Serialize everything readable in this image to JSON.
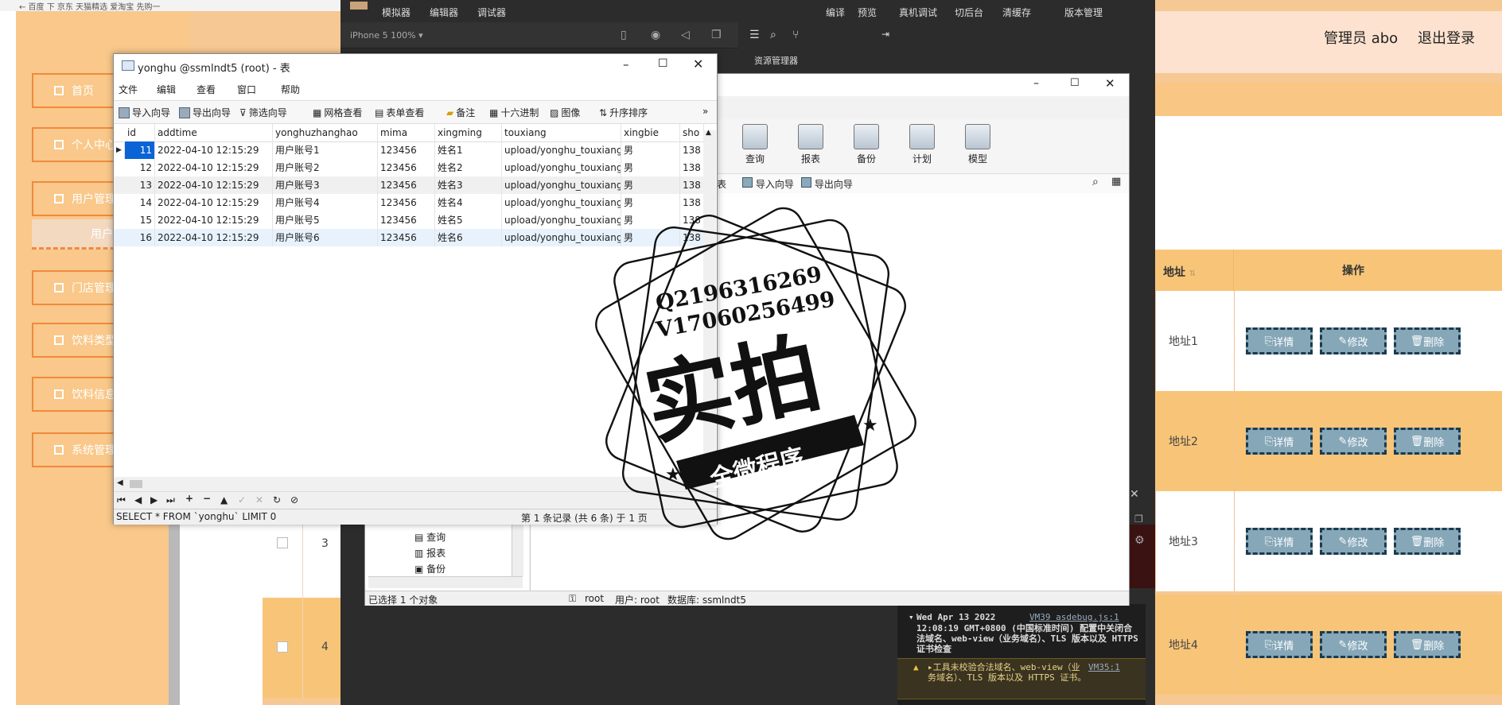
{
  "browser": {
    "tabs_text": "←  百度   下    京东    天猫精选    爱淘宝    先购一"
  },
  "admin": {
    "sidebar": {
      "items": [
        {
          "label": "首页"
        },
        {
          "label": "个人中心"
        },
        {
          "label": "用户管理"
        },
        {
          "label": "门店管理"
        },
        {
          "label": "饮料类型"
        },
        {
          "label": "饮料信息"
        },
        {
          "label": "系统管理"
        }
      ],
      "sub_item": "用户"
    },
    "header": {
      "user": "管理员 abo",
      "logout": "退出登录"
    },
    "table": {
      "col_address": "地址",
      "col_ops": "操作",
      "rows": [
        {
          "index": "",
          "address": "地址1"
        },
        {
          "index": "",
          "address": "地址2"
        },
        {
          "index": "3",
          "address": "地址3"
        },
        {
          "index": "4",
          "address": "地址4"
        }
      ],
      "btn_detail": "详情",
      "btn_edit": "修改",
      "btn_delete": "删除"
    }
  },
  "devtools": {
    "menu": [
      "模拟器",
      "编辑器",
      "调试器"
    ],
    "right_menu": [
      "编译",
      "预览",
      "真机调试",
      "切后台",
      "清缓存",
      "版本管理"
    ],
    "device": "iPhone 5 100%",
    "resource_manager": "资源管理器",
    "console_line1": "Wed Apr 13 2022",
    "console_ref1": "VM39 asdebug.js:1",
    "console_line2": "12:08:19 GMT+0800 (中国标准时间) 配置中关闭合法域名、web-view（业务域名）、TLS 版本以及 HTTPS 证书检查",
    "warn_text": "▸工具未校验合法域名、web-view（业务域名）、TLS 版本以及 HTTPS 证书。",
    "warn_ref": "VM35:1"
  },
  "navicat": {
    "toolbar": [
      "查询",
      "报表",
      "备份",
      "计划",
      "模型"
    ],
    "subbar": [
      "表",
      "导入向导",
      "导出向导"
    ],
    "tree": [
      "查询",
      "报表",
      "备份"
    ],
    "status_left": "已选择 1 个对象",
    "status_user": "root",
    "status_user2": "用户: root",
    "status_db": "数据库: ssmlndt5"
  },
  "table_window": {
    "title": "yonghu @ssmlndt5 (root) - 表",
    "menu": [
      "文件",
      "编辑",
      "查看",
      "窗口",
      "帮助"
    ],
    "toolbar": [
      "导入向导",
      "导出向导",
      "筛选向导",
      "网格查看",
      "表单查看",
      "备注",
      "十六进制",
      "图像",
      "升序排序"
    ],
    "columns": [
      "id",
      "addtime",
      "yonghuzhanghao",
      "mima",
      "xingming",
      "touxiang",
      "xingbie",
      "sho"
    ],
    "rows": [
      [
        "11",
        "2022-04-10 12:15:29",
        "用户账号1",
        "123456",
        "姓名1",
        "upload/yonghu_touxiang",
        "男",
        "138"
      ],
      [
        "12",
        "2022-04-10 12:15:29",
        "用户账号2",
        "123456",
        "姓名2",
        "upload/yonghu_touxiang",
        "男",
        "138"
      ],
      [
        "13",
        "2022-04-10 12:15:29",
        "用户账号3",
        "123456",
        "姓名3",
        "upload/yonghu_touxiang",
        "男",
        "138"
      ],
      [
        "14",
        "2022-04-10 12:15:29",
        "用户账号4",
        "123456",
        "姓名4",
        "upload/yonghu_touxiang",
        "男",
        "138"
      ],
      [
        "15",
        "2022-04-10 12:15:29",
        "用户账号5",
        "123456",
        "姓名5",
        "upload/yonghu_touxiang",
        "男",
        "138"
      ],
      [
        "16",
        "2022-04-10 12:15:29",
        "用户账号6",
        "123456",
        "姓名6",
        "upload/yonghu_touxiangu",
        "男",
        "138"
      ]
    ],
    "sql": "SELECT * FROM `yonghu` LIMIT 0",
    "record_info": "第 1 条记录 (共 6 条) 于 1 页"
  },
  "stamp": {
    "line1": "Q2196316269",
    "line2": "V17060256499",
    "big": "实拍",
    "ribbon": "全微程序"
  }
}
